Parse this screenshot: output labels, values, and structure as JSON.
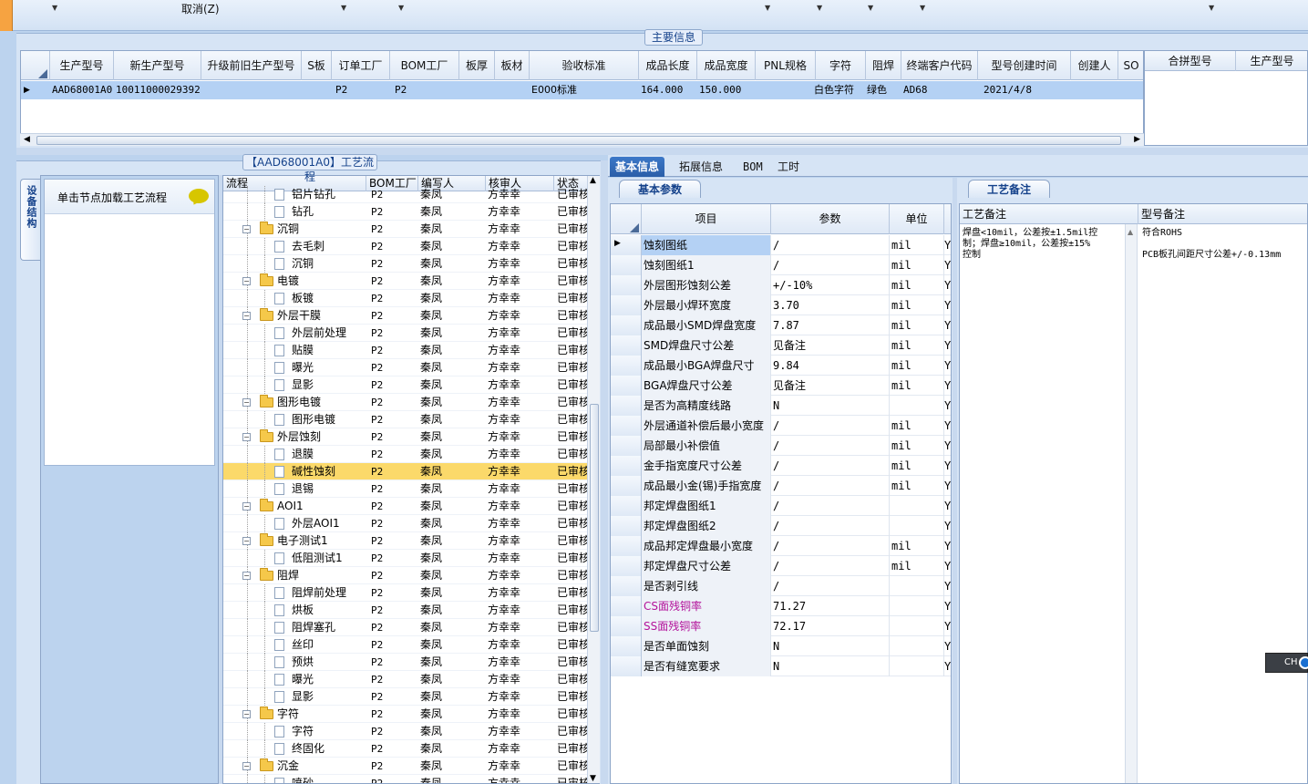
{
  "toolbar": {
    "cancel_label": "取消(Z)"
  },
  "main_info": {
    "title": "主要信息",
    "columns": [
      "生产型号",
      "新生产型号",
      "升级前旧生产型号",
      "S板",
      "订单工厂",
      "BOM工厂",
      "板厚",
      "板材",
      "验收标准",
      "成品长度",
      "成品宽度",
      "PNL规格",
      "字符",
      "阻焊",
      "终端客户代码",
      "型号创建时间",
      "创建人",
      "SO"
    ],
    "row": {
      "production_model": "AAD68001A0",
      "new_model": "10011000029392",
      "old_model": "",
      "s_board": "",
      "order_factory": "P2",
      "bom_factory": "P2",
      "thickness": "",
      "material": "",
      "standard": "E000标准",
      "length": "164.000",
      "width": "150.000",
      "pnl": "",
      "character": "白色字符",
      "solder_mask": "绿色",
      "customer_code": "AD68",
      "create_time": "2021/4/8",
      "creator": "",
      "so": ""
    },
    "merge_columns": [
      "合拼型号",
      "生产型号"
    ]
  },
  "flow": {
    "title": "【AAD68001A0】工艺流程",
    "device_tab": "设备结构",
    "load_label": "单击节点加载工艺流程",
    "columns": [
      "流程",
      "BOM工厂",
      "编写人",
      "核审人",
      "状态"
    ],
    "rows": [
      {
        "name": "铝片钻孔",
        "level": 2,
        "factory": "P2",
        "writer": "秦凤",
        "checker": "方幸幸",
        "status": "已审核"
      },
      {
        "name": "钻孔",
        "level": 2,
        "factory": "P2",
        "writer": "秦凤",
        "checker": "方幸幸",
        "status": "已审核"
      },
      {
        "name": "沉铜",
        "level": 1,
        "factory": "P2",
        "writer": "秦凤",
        "checker": "方幸幸",
        "status": "已审核"
      },
      {
        "name": "去毛刺",
        "level": 2,
        "factory": "P2",
        "writer": "秦凤",
        "checker": "方幸幸",
        "status": "已审核"
      },
      {
        "name": "沉铜",
        "level": 2,
        "factory": "P2",
        "writer": "秦凤",
        "checker": "方幸幸",
        "status": "已审核"
      },
      {
        "name": "电镀",
        "level": 1,
        "factory": "P2",
        "writer": "秦凤",
        "checker": "方幸幸",
        "status": "已审核"
      },
      {
        "name": "板镀",
        "level": 2,
        "factory": "P2",
        "writer": "秦凤",
        "checker": "方幸幸",
        "status": "已审核"
      },
      {
        "name": "外层干膜",
        "level": 1,
        "factory": "P2",
        "writer": "秦凤",
        "checker": "方幸幸",
        "status": "已审核"
      },
      {
        "name": "外层前处理",
        "level": 2,
        "factory": "P2",
        "writer": "秦凤",
        "checker": "方幸幸",
        "status": "已审核"
      },
      {
        "name": "贴膜",
        "level": 2,
        "factory": "P2",
        "writer": "秦凤",
        "checker": "方幸幸",
        "status": "已审核"
      },
      {
        "name": "曝光",
        "level": 2,
        "factory": "P2",
        "writer": "秦凤",
        "checker": "方幸幸",
        "status": "已审核"
      },
      {
        "name": "显影",
        "level": 2,
        "factory": "P2",
        "writer": "秦凤",
        "checker": "方幸幸",
        "status": "已审核"
      },
      {
        "name": "图形电镀",
        "level": 1,
        "factory": "P2",
        "writer": "秦凤",
        "checker": "方幸幸",
        "status": "已审核"
      },
      {
        "name": "图形电镀",
        "level": 2,
        "factory": "P2",
        "writer": "秦凤",
        "checker": "方幸幸",
        "status": "已审核"
      },
      {
        "name": "外层蚀刻",
        "level": 1,
        "factory": "P2",
        "writer": "秦凤",
        "checker": "方幸幸",
        "status": "已审核"
      },
      {
        "name": "退膜",
        "level": 2,
        "factory": "P2",
        "writer": "秦凤",
        "checker": "方幸幸",
        "status": "已审核"
      },
      {
        "name": "碱性蚀刻",
        "level": 2,
        "factory": "P2",
        "writer": "秦凤",
        "checker": "方幸幸",
        "status": "已审核",
        "selected": true
      },
      {
        "name": "退锡",
        "level": 2,
        "factory": "P2",
        "writer": "秦凤",
        "checker": "方幸幸",
        "status": "已审核"
      },
      {
        "name": "AOI1",
        "level": 1,
        "factory": "P2",
        "writer": "秦凤",
        "checker": "方幸幸",
        "status": "已审核"
      },
      {
        "name": "外层AOI1",
        "level": 2,
        "factory": "P2",
        "writer": "秦凤",
        "checker": "方幸幸",
        "status": "已审核"
      },
      {
        "name": "电子测试1",
        "level": 1,
        "factory": "P2",
        "writer": "秦凤",
        "checker": "方幸幸",
        "status": "已审核"
      },
      {
        "name": "低阻测试1",
        "level": 2,
        "factory": "P2",
        "writer": "秦凤",
        "checker": "方幸幸",
        "status": "已审核"
      },
      {
        "name": "阻焊",
        "level": 1,
        "factory": "P2",
        "writer": "秦凤",
        "checker": "方幸幸",
        "status": "已审核"
      },
      {
        "name": "阻焊前处理",
        "level": 2,
        "factory": "P2",
        "writer": "秦凤",
        "checker": "方幸幸",
        "status": "已审核"
      },
      {
        "name": "烘板",
        "level": 2,
        "factory": "P2",
        "writer": "秦凤",
        "checker": "方幸幸",
        "status": "已审核"
      },
      {
        "name": "阻焊塞孔",
        "level": 2,
        "factory": "P2",
        "writer": "秦凤",
        "checker": "方幸幸",
        "status": "已审核"
      },
      {
        "name": "丝印",
        "level": 2,
        "factory": "P2",
        "writer": "秦凤",
        "checker": "方幸幸",
        "status": "已审核"
      },
      {
        "name": "预烘",
        "level": 2,
        "factory": "P2",
        "writer": "秦凤",
        "checker": "方幸幸",
        "status": "已审核"
      },
      {
        "name": "曝光",
        "level": 2,
        "factory": "P2",
        "writer": "秦凤",
        "checker": "方幸幸",
        "status": "已审核"
      },
      {
        "name": "显影",
        "level": 2,
        "factory": "P2",
        "writer": "秦凤",
        "checker": "方幸幸",
        "status": "已审核"
      },
      {
        "name": "字符",
        "level": 1,
        "factory": "P2",
        "writer": "秦凤",
        "checker": "方幸幸",
        "status": "已审核"
      },
      {
        "name": "字符",
        "level": 2,
        "factory": "P2",
        "writer": "秦凤",
        "checker": "方幸幸",
        "status": "已审核"
      },
      {
        "name": "终固化",
        "level": 2,
        "factory": "P2",
        "writer": "秦凤",
        "checker": "方幸幸",
        "status": "已审核"
      },
      {
        "name": "沉金",
        "level": 1,
        "factory": "P2",
        "writer": "秦凤",
        "checker": "方幸幸",
        "status": "已审核"
      },
      {
        "name": "喷砂",
        "level": 2,
        "factory": "P2",
        "writer": "秦凤",
        "checker": "方幸幸",
        "status": "已审核"
      }
    ]
  },
  "tabs": [
    "基本信息",
    "拓展信息",
    "BOM",
    "工时"
  ],
  "basic": {
    "subtab": "基本参数",
    "columns": [
      "项目",
      "参数",
      "单位"
    ],
    "rows": [
      {
        "item": "蚀刻图纸",
        "param": "/",
        "unit": "mil",
        "y": "Y",
        "selected": true
      },
      {
        "item": "蚀刻图纸1",
        "param": "/",
        "unit": "mil",
        "y": "Y"
      },
      {
        "item": "外层图形蚀刻公差",
        "param": "+/-10%",
        "unit": "mil",
        "y": "Y"
      },
      {
        "item": "外层最小焊环宽度",
        "param": "3.70",
        "unit": "mil",
        "y": "Y"
      },
      {
        "item": "成品最小SMD焊盘宽度",
        "param": "7.87",
        "unit": "mil",
        "y": "Y"
      },
      {
        "item": "SMD焊盘尺寸公差",
        "param": "见备注",
        "unit": "mil",
        "y": "Y"
      },
      {
        "item": "成品最小BGA焊盘尺寸",
        "param": "9.84",
        "unit": "mil",
        "y": "Y"
      },
      {
        "item": "BGA焊盘尺寸公差",
        "param": "见备注",
        "unit": "mil",
        "y": "Y"
      },
      {
        "item": "是否为高精度线路",
        "param": "N",
        "unit": "",
        "y": "Y"
      },
      {
        "item": "外层通道补偿后最小宽度",
        "param": "/",
        "unit": "mil",
        "y": "Y"
      },
      {
        "item": "局部最小补偿值",
        "param": "/",
        "unit": "mil",
        "y": "Y"
      },
      {
        "item": "金手指宽度尺寸公差",
        "param": "/",
        "unit": "mil",
        "y": "Y"
      },
      {
        "item": "成品最小金(锡)手指宽度",
        "param": "/",
        "unit": "mil",
        "y": "Y"
      },
      {
        "item": "邦定焊盘图纸1",
        "param": "/",
        "unit": "",
        "y": "Y"
      },
      {
        "item": "邦定焊盘图纸2",
        "param": "/",
        "unit": "",
        "y": "Y"
      },
      {
        "item": "成品邦定焊盘最小宽度",
        "param": "/",
        "unit": "mil",
        "y": "Y"
      },
      {
        "item": "邦定焊盘尺寸公差",
        "param": "/",
        "unit": "mil",
        "y": "Y"
      },
      {
        "item": "是否剥引线",
        "param": "/",
        "unit": "",
        "y": "Y"
      },
      {
        "item": "CS面残铜率",
        "param": "71.27",
        "unit": "",
        "y": "Y",
        "pink": true
      },
      {
        "item": "SS面残铜率",
        "param": "72.17",
        "unit": "",
        "y": "Y",
        "pink": true
      },
      {
        "item": "是否单面蚀刻",
        "param": "N",
        "unit": "",
        "y": "Y"
      },
      {
        "item": "是否有缝宽要求",
        "param": "N",
        "unit": "",
        "y": "Y"
      }
    ]
  },
  "notes": {
    "subtab": "工艺备注",
    "process_header": "工艺备注",
    "model_header": "型号备注",
    "process_note": "焊盘<10mil，公差按±1.5mil控\n制；焊盘≥10mil，公差按±15%\n控制",
    "model_note": "符合ROHS\n\nPCB板孔间距尺寸公差+/-0.13mm"
  },
  "ime": {
    "label": "CH"
  }
}
